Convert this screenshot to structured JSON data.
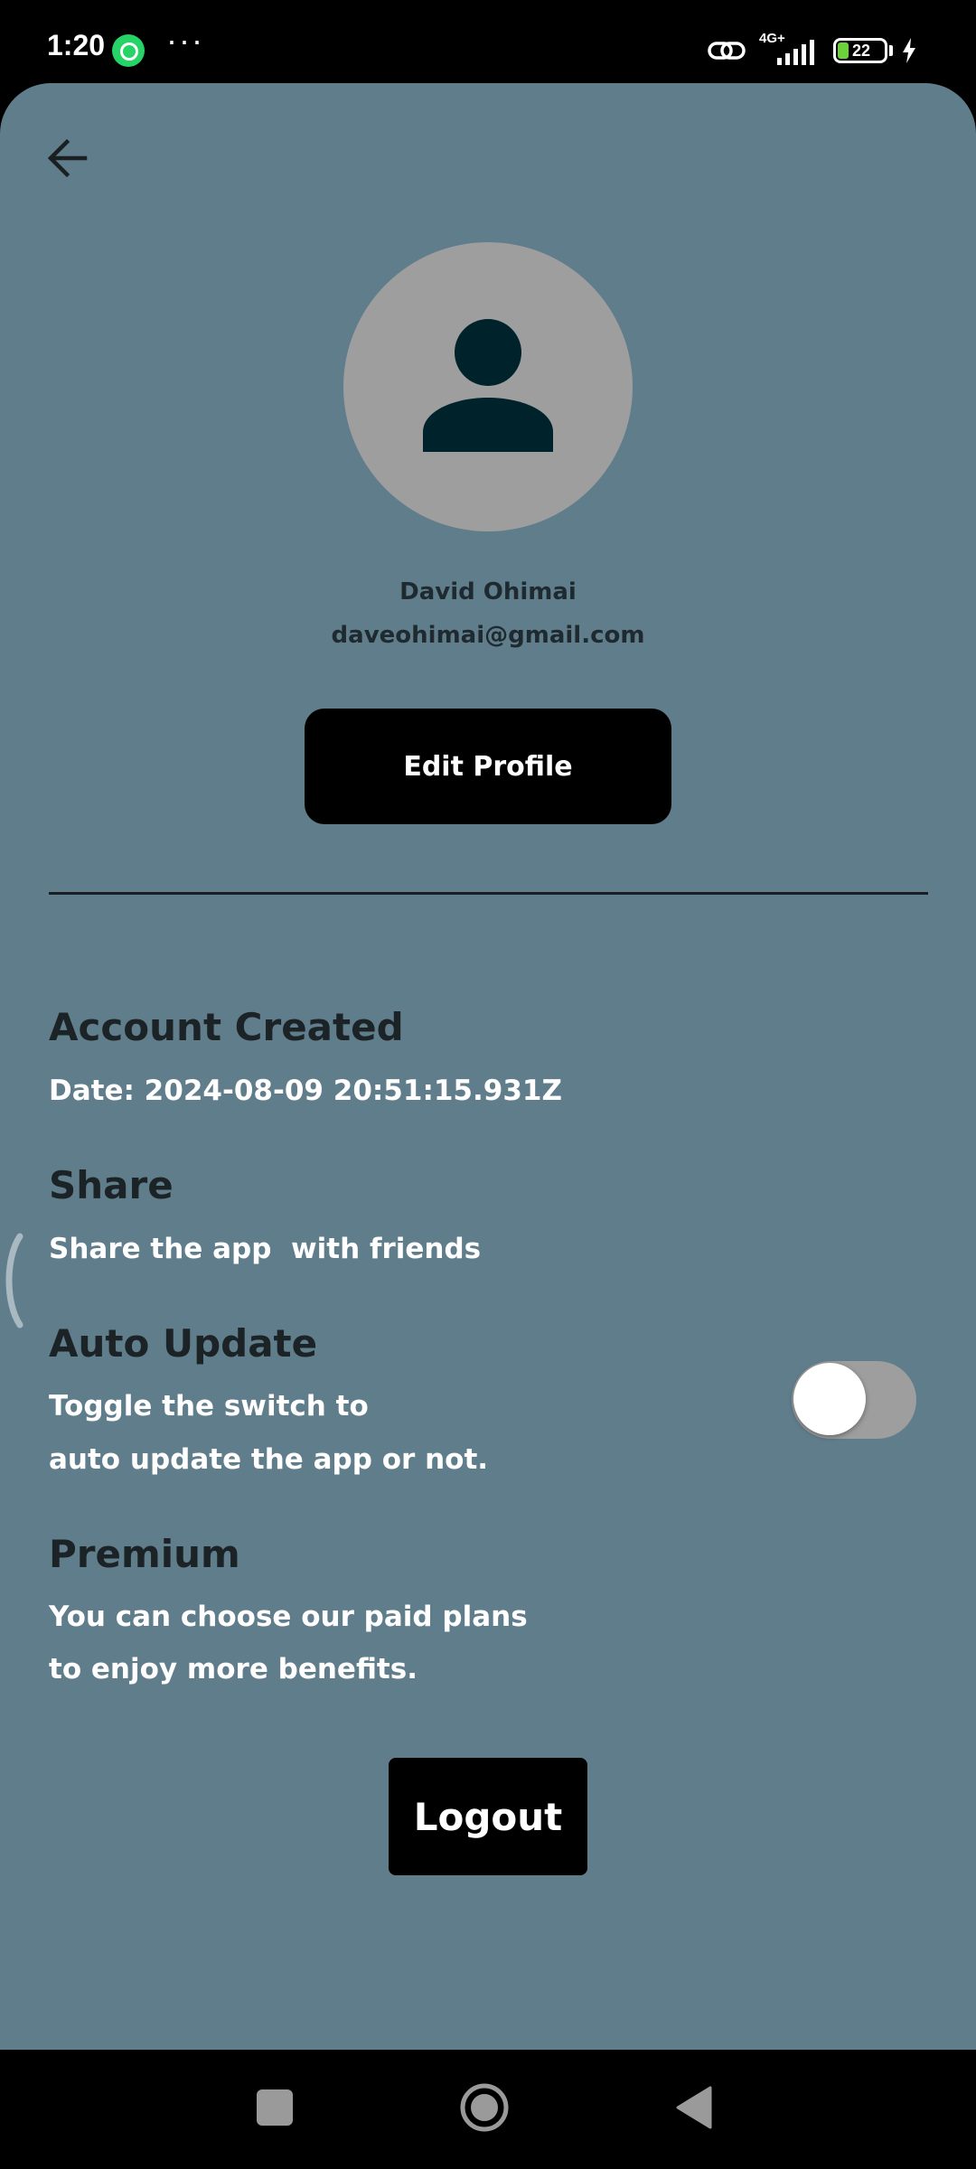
{
  "status_bar": {
    "time": "1:20",
    "notification_icons": [
      "whatsapp-icon"
    ],
    "overflow": "···",
    "network_label": "4G+",
    "battery_level": "22",
    "charging": true
  },
  "header": {
    "back_icon": "arrow-left-icon"
  },
  "profile": {
    "avatar_icon": "person-icon",
    "name": "David Ohimai",
    "email": "daveohimai@gmail.com",
    "edit_button_label": "Edit Profile"
  },
  "sections": {
    "account": {
      "title": "Account Created",
      "text": "Date: 2024-08-09 20:51:15.931Z"
    },
    "share": {
      "title": "Share",
      "text": "Share the app  with friends"
    },
    "auto_update": {
      "title": "Auto Update",
      "text_line1": "Toggle the switch to",
      "text_line2": "auto update the app or not.",
      "toggle_on": false
    },
    "premium": {
      "title": "Premium",
      "text_line1": "You can choose our paid plans",
      "text_line2": "to enjoy more benefits."
    }
  },
  "logout_label": "Logout",
  "colors": {
    "background": "#607d8b",
    "button": "#000000",
    "title_text": "#1c2326",
    "body_text": "#ffffff",
    "avatar_bg": "#9e9e9e",
    "avatar_icon": "#00222b",
    "toggle_track": "#9e9e9e"
  },
  "nav_bar": {
    "buttons": [
      "recents-icon",
      "home-icon",
      "back-icon"
    ]
  }
}
